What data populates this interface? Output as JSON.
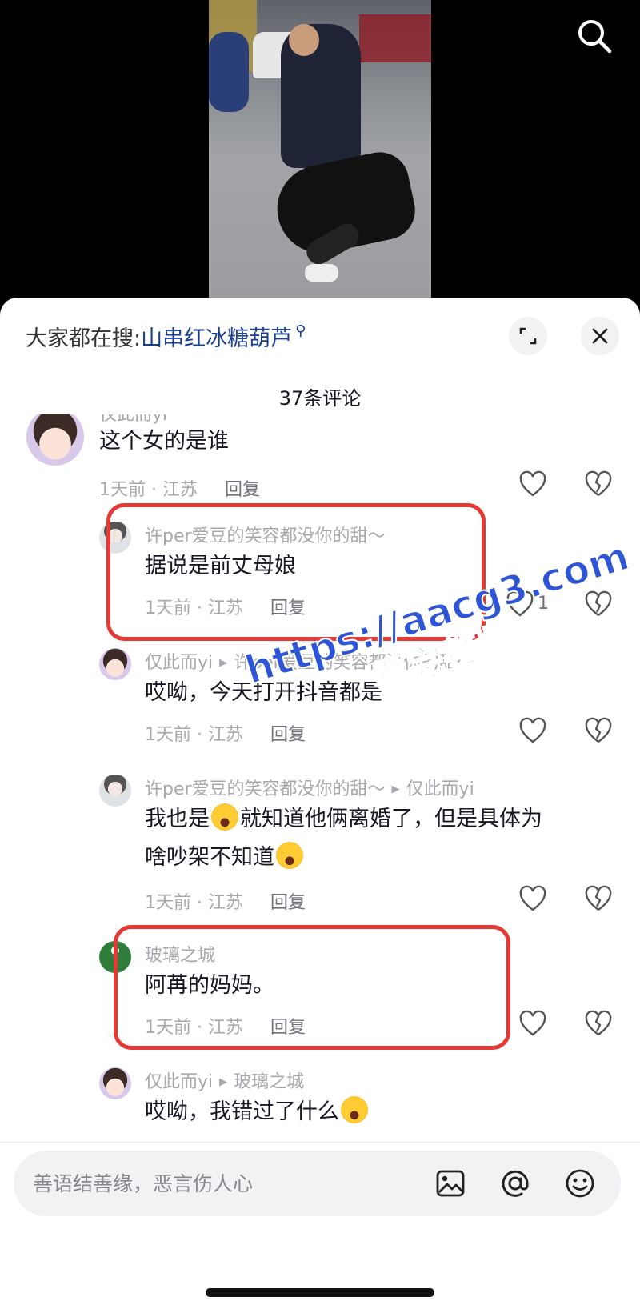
{
  "video": {
    "description_icon": "search-icon"
  },
  "sheet": {
    "search_prefix": "大家都在搜:",
    "search_term": "山串红冰糖葫芦",
    "search_glyph": "⚲",
    "comment_count": "37条评论",
    "buttons": {
      "expand": "expand-icon",
      "close": "close-icon"
    }
  },
  "comments": [
    {
      "user": "仅此而yi",
      "text": "这个女的是谁",
      "time": "1天前 · 江苏",
      "reply": "回复",
      "likes": ""
    },
    {
      "user": "许per爱豆的笑容都没你的甜～",
      "text": "据说是前丈母娘",
      "time": "1天前 · 江苏",
      "reply": "回复",
      "likes": "1"
    },
    {
      "user": "仅此而yi",
      "reply_to": "许per爱豆的笑容都没你的甜～",
      "text": "哎呦，今天打开抖音都是",
      "time": "1天前 · 江苏",
      "reply": "回复",
      "likes": ""
    },
    {
      "user": "许per爱豆的笑容都没你的甜～",
      "reply_to": "仅此而yi",
      "text_line1a": "我也是",
      "text_line1b": "就知道他俩离婚了，但是具体为",
      "text_line2": "啥吵架不知道",
      "time": "1天前 · 江苏",
      "reply": "回复",
      "likes": ""
    },
    {
      "user": "玻璃之城",
      "text": "阿苒的妈妈。",
      "time": "1天前 · 江苏",
      "reply": "回复",
      "likes": ""
    },
    {
      "user": "仅此而yi",
      "reply_to": "玻璃之城",
      "text": "哎呦，我错过了什么",
      "time": "",
      "reply": "",
      "likes": ""
    }
  ],
  "watermark": {
    "url": "https://aacg3.com",
    "sub": "看完整版"
  },
  "input": {
    "placeholder": "善语结善缘，恶言伤人心",
    "icons": [
      "image-icon",
      "at-icon",
      "emoji-icon"
    ]
  },
  "colors": {
    "highlight": "#e53935",
    "link_blue": "#1b3f8f",
    "watermark_blue": "#2d55d6",
    "meta_gray": "#a7a8ad"
  }
}
